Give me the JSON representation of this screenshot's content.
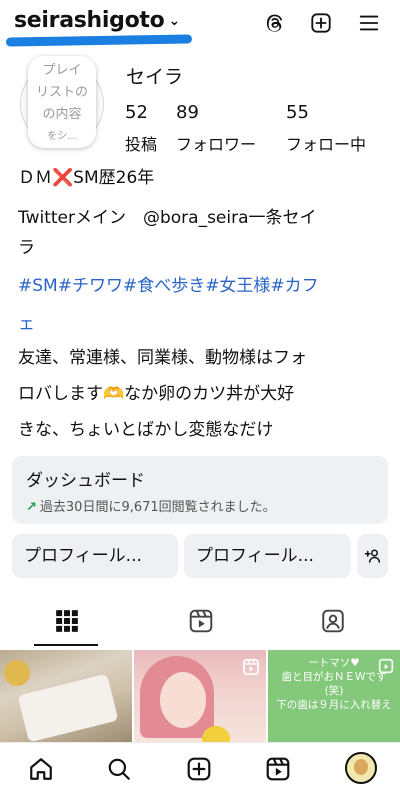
{
  "header": {
    "username": "seirashigoto",
    "chevron": "⌄",
    "icons": [
      "threads-icon",
      "plus-square-icon",
      "menu-icon"
    ]
  },
  "profile": {
    "note": [
      "プレイ",
      "リストの",
      "の内容",
      "をシ..."
    ],
    "full_name": "セイラ",
    "stats": [
      {
        "count": "52",
        "label": "投稿"
      },
      {
        "count": "89",
        "label": "フォロワー"
      },
      {
        "count": "55",
        "label": "フォロー中"
      }
    ]
  },
  "bio": {
    "line1_pre": "ＤＭ",
    "line1_emoji": "❌",
    "line1_post": "SM歴26年",
    "line2": "Twitterメイン　@bora_seira一条セイ",
    "line3": "ラ",
    "tags1": "#SM#チワワ#食べ歩き#女王様#カフ",
    "tags2": "ェ",
    "line4": "友達、常連様、同業様、動物様はフォ",
    "line5_pre": "ロバします",
    "line5_emoji": "🫶",
    "line5_post": "なか卵のカツ丼が大好",
    "line6": "きな、ちょいとばかし変態なだけ"
  },
  "dashboard": {
    "title": "ダッシュボード",
    "arrow": "↗",
    "subtitle": "過去30日間に9,671回閲覧されました。"
  },
  "buttons": {
    "profile_edit": "プロフィール...",
    "profile_share": "プロフィール..."
  },
  "tabs": [
    "grid-icon",
    "reels-icon",
    "tagged-icon"
  ],
  "grid": {
    "post3_lines": [
      "ートマソ♥",
      "歯と目がおＮＥＷです",
      "(笑)",
      "下の歯は９月に入れ替え"
    ]
  },
  "bottom_nav": [
    "home-icon",
    "search-icon",
    "create-icon",
    "reels-icon",
    "profile-icon"
  ],
  "colors": {
    "accent_link": "#2b64c8",
    "highlight_underline": "#1a7fe0",
    "button_bg": "#eef0f3"
  }
}
